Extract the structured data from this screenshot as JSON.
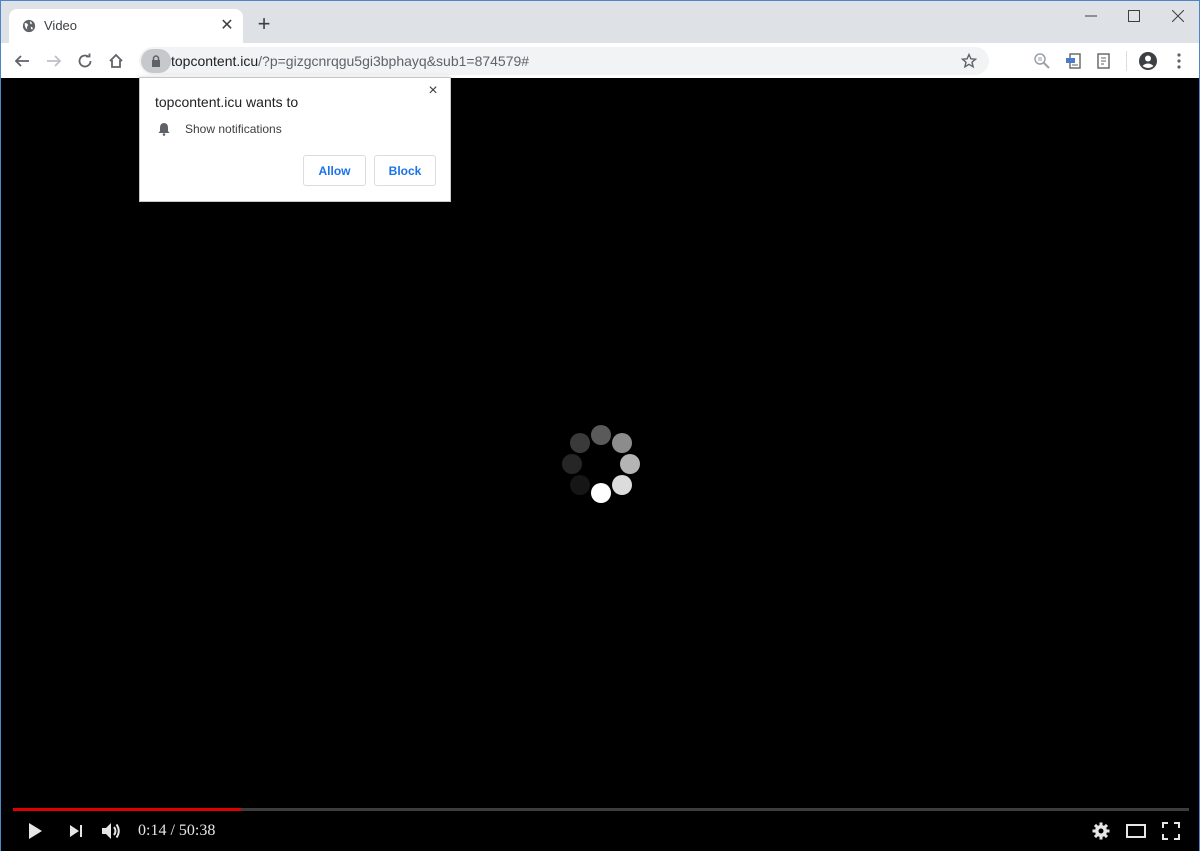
{
  "browser": {
    "tab": {
      "title": "Video",
      "icon": "globe-icon"
    },
    "new_tab_label": "+",
    "window_controls": [
      "minimize",
      "maximize",
      "close"
    ],
    "address_bar": {
      "domain": "topcontent.icu",
      "path": "/?p=gizgcnrqgu5gi3bphayq&sub1=874579#"
    },
    "toolbar_icons": [
      "back-icon",
      "forward-icon",
      "reload-icon",
      "home-icon",
      "star-icon",
      "zoom-icon",
      "extension-pdf-icon",
      "extension-reader-icon",
      "profile-icon",
      "menu-icon"
    ]
  },
  "permission_prompt": {
    "title": "topcontent.icu wants to",
    "permission": "Show notifications",
    "allow_label": "Allow",
    "block_label": "Block",
    "close_label": "×"
  },
  "player": {
    "current_time": "0:14",
    "duration": "50:38",
    "time_display": "0:14 / 50:38",
    "progress_fraction": 0.194,
    "loading": true,
    "colors": {
      "progress_played": "#e00000",
      "progress_track": "#3d3d3d"
    }
  }
}
